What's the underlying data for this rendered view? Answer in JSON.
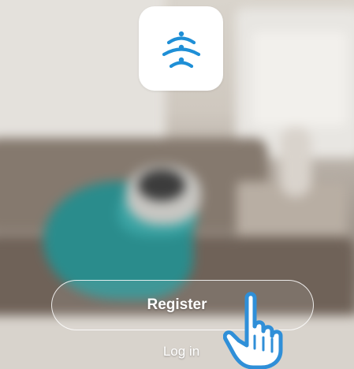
{
  "colors": {
    "brand_blue": "#1f8fd6",
    "button_text": "#ffffff",
    "hand_outline": "#2f8fd8"
  },
  "icons": {
    "app": "wifi-signal-icon",
    "pointer": "hand-pointer-icon"
  },
  "actions": {
    "register_label": "Register",
    "login_label": "Log in"
  }
}
